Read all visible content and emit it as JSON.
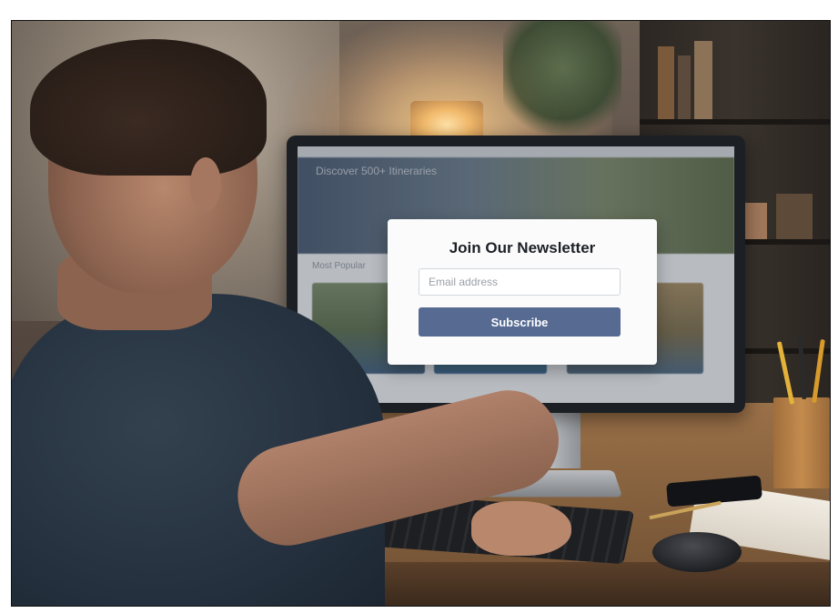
{
  "screen": {
    "hero_text": "Discover 500+ Itineraries",
    "section_text": "Most Popular",
    "newsletter": {
      "title": "Join Our Newsletter",
      "email_placeholder": "Email address",
      "subscribe_label": "Subscribe"
    }
  },
  "colors": {
    "subscribe_button": "#566a92",
    "modal_background": "#fbfbfb"
  }
}
